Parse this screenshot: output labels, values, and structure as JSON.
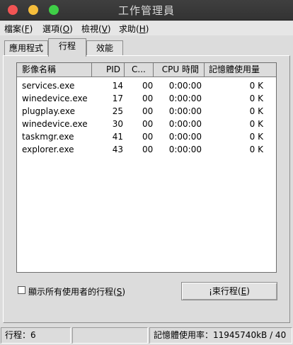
{
  "window": {
    "title": "工作管理員"
  },
  "menu": [
    {
      "label": "檔案",
      "key": "F"
    },
    {
      "label": "選項",
      "key": "O"
    },
    {
      "label": "檢視",
      "key": "V"
    },
    {
      "label": "求助",
      "key": "H"
    }
  ],
  "tabs": [
    {
      "label": "應用程式",
      "active": false
    },
    {
      "label": "行程",
      "active": true
    },
    {
      "label": "效能",
      "active": false
    }
  ],
  "table": {
    "columns": [
      "影像名稱",
      "PID",
      "C...",
      "CPU 時間",
      "記憶體使用量"
    ],
    "rows": [
      [
        "services.exe",
        "14",
        "00",
        "0:00:00",
        "0 K"
      ],
      [
        "winedevice.exe",
        "17",
        "00",
        "0:00:00",
        "0 K"
      ],
      [
        "plugplay.exe",
        "25",
        "00",
        "0:00:00",
        "0 K"
      ],
      [
        "winedevice.exe",
        "30",
        "00",
        "0:00:00",
        "0 K"
      ],
      [
        "taskmgr.exe",
        "41",
        "00",
        "0:00:00",
        "0 K"
      ],
      [
        "explorer.exe",
        "43",
        "00",
        "0:00:00",
        "0 K"
      ]
    ]
  },
  "show_all": {
    "label": "顯示所有使用者的行程",
    "key": "S",
    "checked": false
  },
  "end_button": {
    "label": "¡束行程",
    "key": "E"
  },
  "statusbar": {
    "processes": "行程：6",
    "memory": "記憶體使用率：11945740kB / 40"
  },
  "colors": {
    "titlebar": "#3a3a3a",
    "window": "#dcdcdc",
    "close": "#f25454",
    "minimize": "#f5bd3b",
    "maximize": "#3fcf47"
  }
}
